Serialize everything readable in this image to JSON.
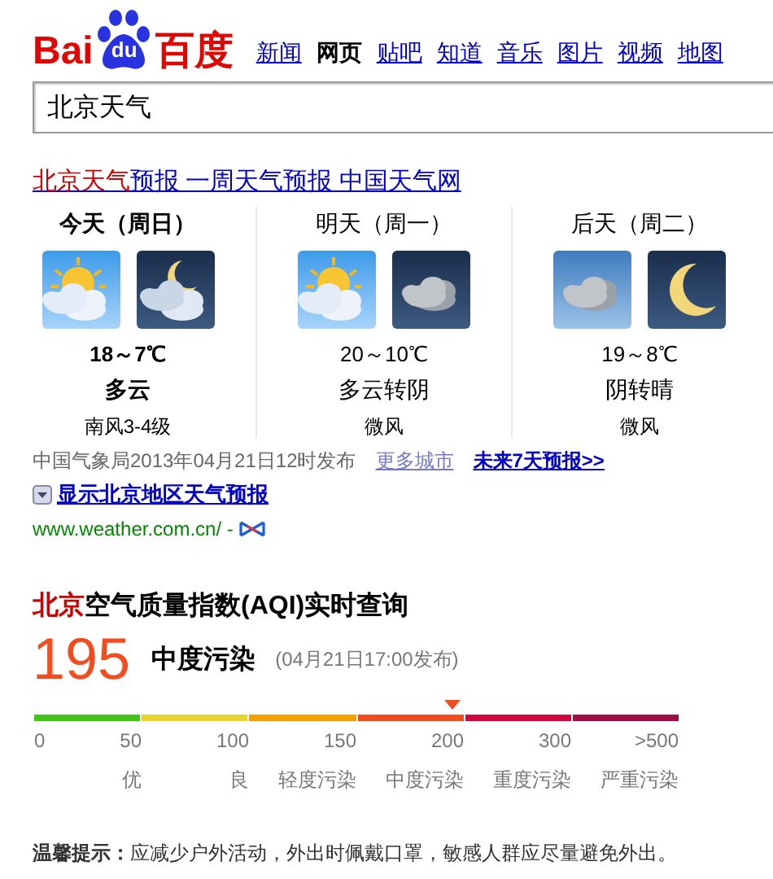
{
  "logo": {
    "left": "Bai",
    "badge": "du",
    "right": "百度"
  },
  "nav": [
    {
      "label": "新闻",
      "selected": false
    },
    {
      "label": "网页",
      "selected": true
    },
    {
      "label": "贴吧",
      "selected": false
    },
    {
      "label": "知道",
      "selected": false
    },
    {
      "label": "音乐",
      "selected": false
    },
    {
      "label": "图片",
      "selected": false
    },
    {
      "label": "视频",
      "selected": false
    },
    {
      "label": "地图",
      "selected": false
    }
  ],
  "search": {
    "value": "北京天气"
  },
  "result": {
    "title": [
      {
        "text": "北京天气",
        "highlight": true
      },
      {
        "text": "预报 一周天气预报 中国天气网",
        "highlight": false
      }
    ],
    "days": [
      {
        "label": "今天（周日）",
        "today": true,
        "icons": [
          {
            "kind": "sun-cloud"
          },
          {
            "kind": "moon-cloud"
          }
        ],
        "temp": "18～7℃",
        "condition": "多云",
        "wind": "南风3-4级"
      },
      {
        "label": "明天（周一）",
        "today": false,
        "icons": [
          {
            "kind": "sun-cloud"
          },
          {
            "kind": "cloud-night"
          }
        ],
        "temp": "20～10℃",
        "condition": "多云转阴",
        "wind": "微风"
      },
      {
        "label": "后天（周二）",
        "today": false,
        "icons": [
          {
            "kind": "cloud"
          },
          {
            "kind": "moon"
          }
        ],
        "temp": "19～8℃",
        "condition": "阴转晴",
        "wind": "微风"
      }
    ],
    "source": "中国气象局2013年04月21日12时发布",
    "more_cities": "更多城市",
    "seven_days": "未来7天预报>>",
    "expand": "显示北京地区天气预报",
    "url": "www.weather.com.cn/ -"
  },
  "aqi": {
    "title_city": "北京",
    "title_rest": "空气质量指数(AQI)实时查询",
    "value": "195",
    "level_label": "中度污染",
    "time": "(04月21日17:00发布)",
    "segments": [
      {
        "color": "#43c41a",
        "tick": "50",
        "label": "优"
      },
      {
        "color": "#e8d42e",
        "tick": "100",
        "label": "良"
      },
      {
        "color": "#f5a000",
        "tick": "150",
        "label": "轻度污染"
      },
      {
        "color": "#f24d1e",
        "tick": "200",
        "label": "中度污染"
      },
      {
        "color": "#d3063f",
        "tick": "300",
        "label": "重度污染"
      },
      {
        "color": "#9c0f45",
        "tick": ">500",
        "label": "严重污染"
      }
    ],
    "start_tick": "0",
    "tip": "**温馨提示：**应减少户外活动，外出时佩戴口罩，敏感人群应尽量避免外出。"
  }
}
